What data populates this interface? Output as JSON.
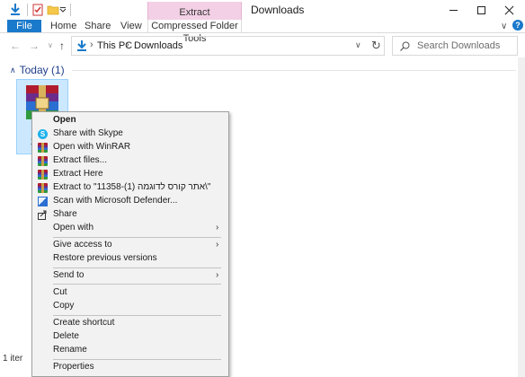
{
  "window": {
    "title": "Downloads",
    "context_group": "Extract",
    "tabs": {
      "file": "File",
      "home": "Home",
      "share": "Share",
      "view": "View",
      "tools": "Compressed Folder Tools"
    },
    "help": "?"
  },
  "address": {
    "crumbs": [
      "This PC",
      "Downloads"
    ],
    "search_placeholder": "Search Downloads"
  },
  "content": {
    "group_header": "Today (1)",
    "file_name": "ס\n113",
    "status": "1 iter"
  },
  "menu": {
    "items": [
      {
        "label": "Open",
        "icon": "none",
        "bold": true
      },
      {
        "label": "Share with Skype",
        "icon": "skype-icon"
      },
      {
        "label": "Open with WinRAR",
        "icon": "winrar-icon"
      },
      {
        "label": "Extract files...",
        "icon": "winrar-icon"
      },
      {
        "label": "Extract Here",
        "icon": "winrar-icon"
      },
      {
        "label": "Extract to \"11358-אתר קורס לדוגמה (1)\\\"",
        "icon": "winrar-icon"
      },
      {
        "label": "Scan with Microsoft Defender...",
        "icon": "defender-icon"
      },
      {
        "label": "Share",
        "icon": "share-icon"
      },
      {
        "label": "Open with",
        "icon": "none",
        "submenu": true
      },
      {
        "label": "Give access to",
        "icon": "none",
        "submenu": true
      },
      {
        "label": "Restore previous versions",
        "icon": "none"
      },
      {
        "label": "Send to",
        "icon": "none",
        "submenu": true
      },
      {
        "label": "Cut",
        "icon": "none"
      },
      {
        "label": "Copy",
        "icon": "none"
      },
      {
        "label": "Create shortcut",
        "icon": "none"
      },
      {
        "label": "Delete",
        "icon": "none"
      },
      {
        "label": "Rename",
        "icon": "none"
      },
      {
        "label": "Properties",
        "icon": "none"
      }
    ]
  },
  "colors": {
    "accent": "#1979ca",
    "context_tab": "#f3d0e6",
    "selection": "#cce8ff",
    "group_header": "#1e3e8a"
  }
}
